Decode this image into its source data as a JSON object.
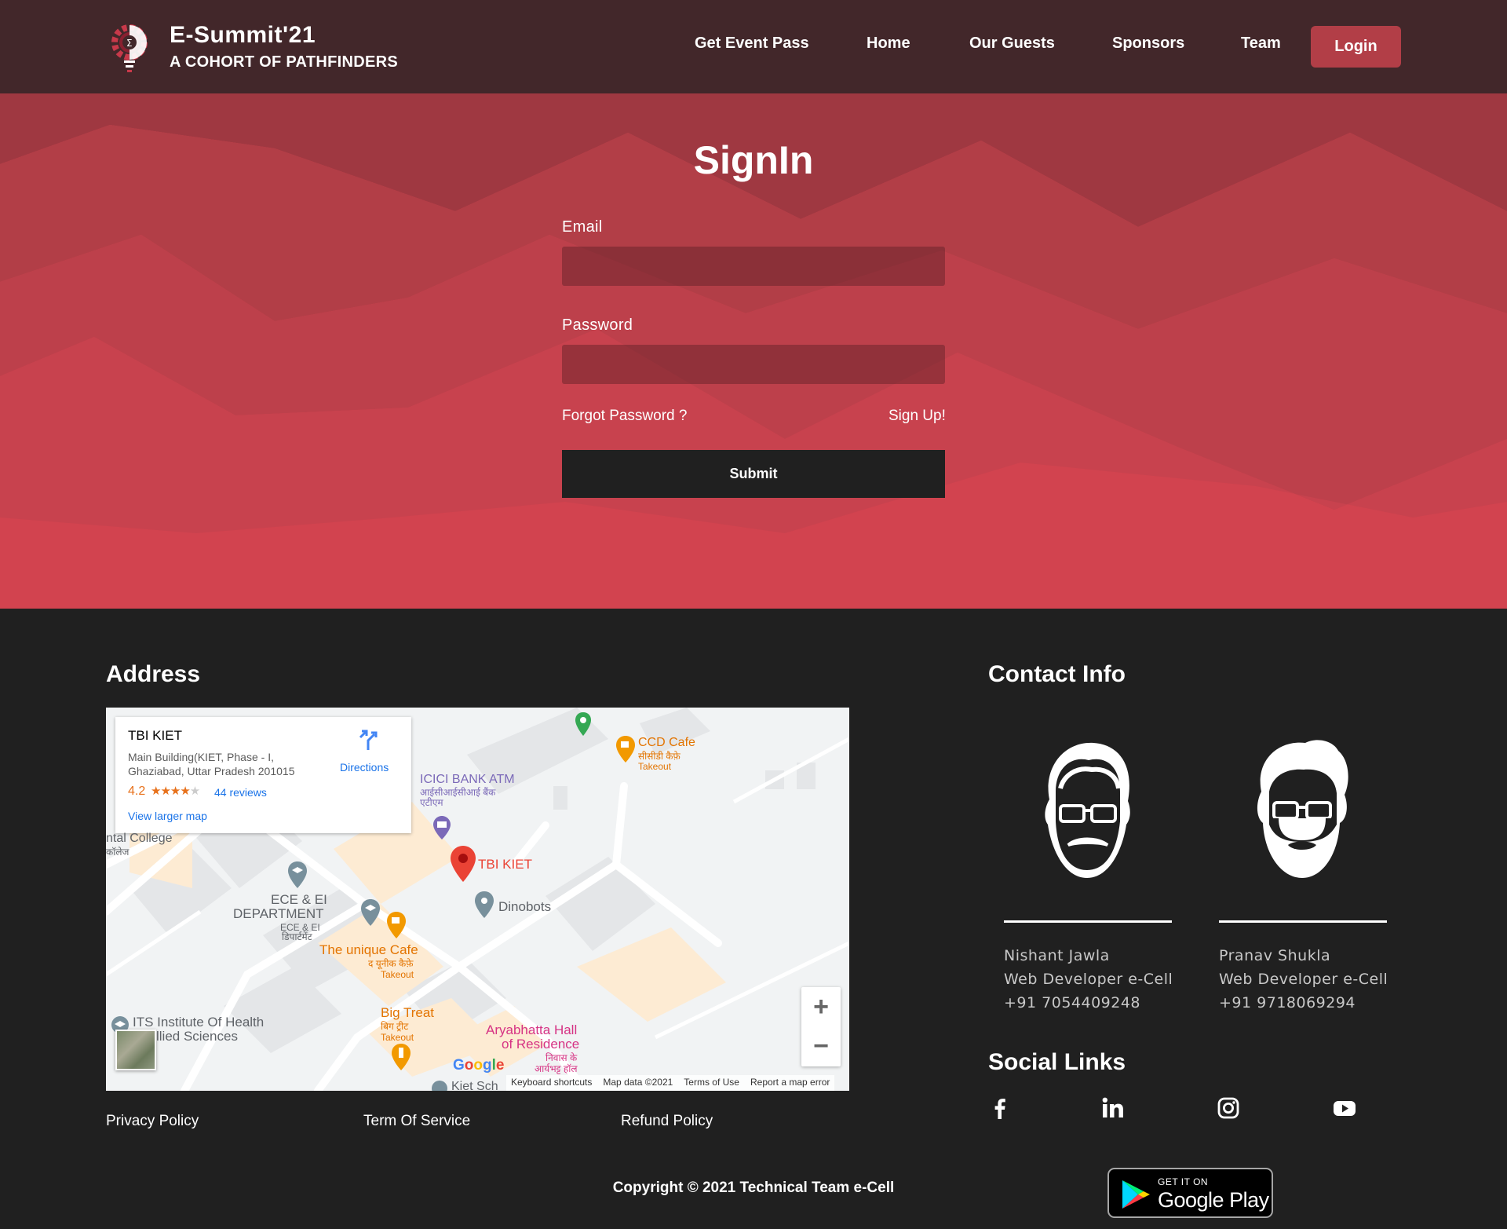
{
  "nav": {
    "brand_title": "E-Summit'21",
    "brand_subtitle": "A COHORT OF PATHFINDERS",
    "links": [
      "Get Event Pass",
      "Home",
      "Our Guests",
      "Sponsors",
      "Team"
    ],
    "login_label": "Login"
  },
  "signin": {
    "title": "SignIn",
    "email_label": "Email",
    "email_value": "",
    "password_label": "Password",
    "password_value": "",
    "forgot_label": "Forgot Password ?",
    "signup_label": "Sign Up!",
    "submit_label": "Submit"
  },
  "address": {
    "title": "Address",
    "map": {
      "place_name": "TBI KIET",
      "place_address": "Main Building(KIET, Phase - I, Ghaziabad, Uttar Pradesh 201015",
      "rating": "4.2",
      "reviews": "44 reviews",
      "view_larger": "View larger map",
      "directions": "Directions",
      "labels": {
        "icici": "ICICI BANK ATM",
        "icici_hi": "आईसीआईसीआई बैंक एटीएम",
        "ccd": "CCD Cafe",
        "ccd_hi": "सीसीडी कैफ़े",
        "ccd_takeout": "Takeout",
        "dental": "ntal College",
        "dental_hi": "कॉलेज",
        "tbi": "TBI KIET",
        "dinobots": "Dinobots",
        "ece": "ECE & EI",
        "dept": "DEPARTMENT",
        "ece_hi": "ECE & EI",
        "dept_hi": "डिपार्टमेंट",
        "unique": "The unique Cafe",
        "unique_hi": "द यूनीक कैफ़े",
        "unique_takeout": "Takeout",
        "bigtreat": "Big Treat",
        "bigtreat_hi": "बिग ट्रीट",
        "bigtreat_takeout": "Takeout",
        "its1": "ITS Institute Of Health",
        "its2": "llied Sciences",
        "arya1": "Aryabhatta Hall",
        "arya2": "of Residence",
        "arya_hi1": "निवास के",
        "arya_hi2": "आर्यभट्ट हॉल",
        "kiet": "Kiet Sch"
      },
      "google": "Google",
      "footer": [
        "Keyboard shortcuts",
        "Map data ©2021",
        "Terms of Use",
        "Report a map error"
      ]
    },
    "policies": [
      "Privacy Policy",
      "Term Of Service",
      "Refund Policy"
    ]
  },
  "contact": {
    "title": "Contact Info",
    "people": [
      {
        "name": "Nishant Jawla",
        "role": "Web Developer e-Cell",
        "phone": "+91 7054409248"
      },
      {
        "name": "Pranav Shukla",
        "role": "Web Developer e-Cell",
        "phone": "+91 9718069294"
      }
    ]
  },
  "social": {
    "title": "Social Links",
    "icons": [
      "facebook-icon",
      "linkedin-icon",
      "instagram-icon",
      "youtube-icon"
    ]
  },
  "playstore": {
    "small": "GET IT ON",
    "big": "Google Play"
  },
  "copyright": "Copyright © 2021 Technical Team e-Cell",
  "colors": {
    "nav_bg": "#42272a",
    "hero_bg": "#d2434f",
    "login_bg": "#b23e47",
    "footer_bg": "#202020"
  }
}
